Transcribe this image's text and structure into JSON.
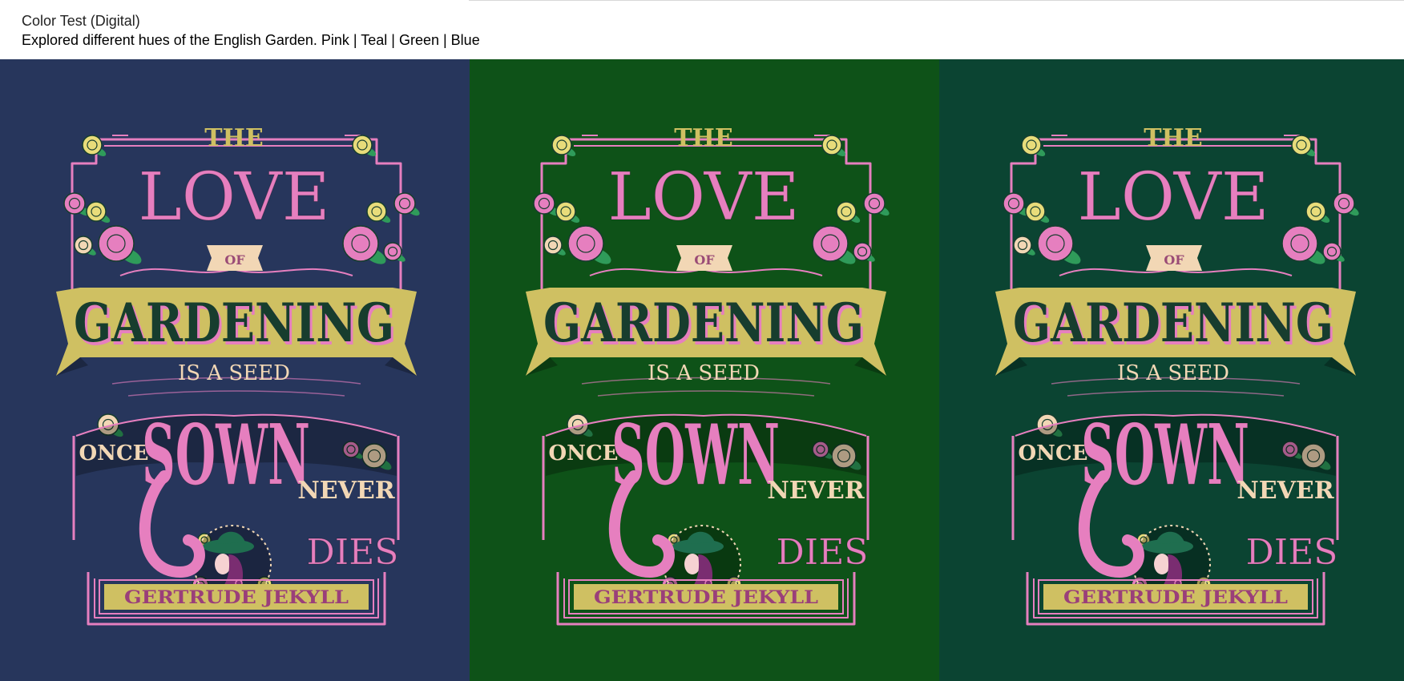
{
  "header": {
    "title": "Color Test (Digital)",
    "subtitle": "Explored different hues of the English Garden. Pink | Teal | Green | Blue"
  },
  "poster": {
    "the": "THE",
    "love": "LOVE",
    "of": "OF",
    "gardening": "GARDENING",
    "is_a_seed": "IS A SEED",
    "once": "ONCE",
    "sown": "SOWN",
    "never": "NEVER",
    "dies": "DIES",
    "author": "GERTRUDE JEKYLL"
  },
  "palette": {
    "pink": "#e67fbf",
    "gold": "#cfc062",
    "cream": "#f2d7b5",
    "dark_green_text": "#173d2e"
  },
  "panels": [
    {
      "name": "blue",
      "background": "#27365c"
    },
    {
      "name": "green",
      "background": "#0e5218"
    },
    {
      "name": "teal",
      "background": "#0b4432"
    }
  ]
}
